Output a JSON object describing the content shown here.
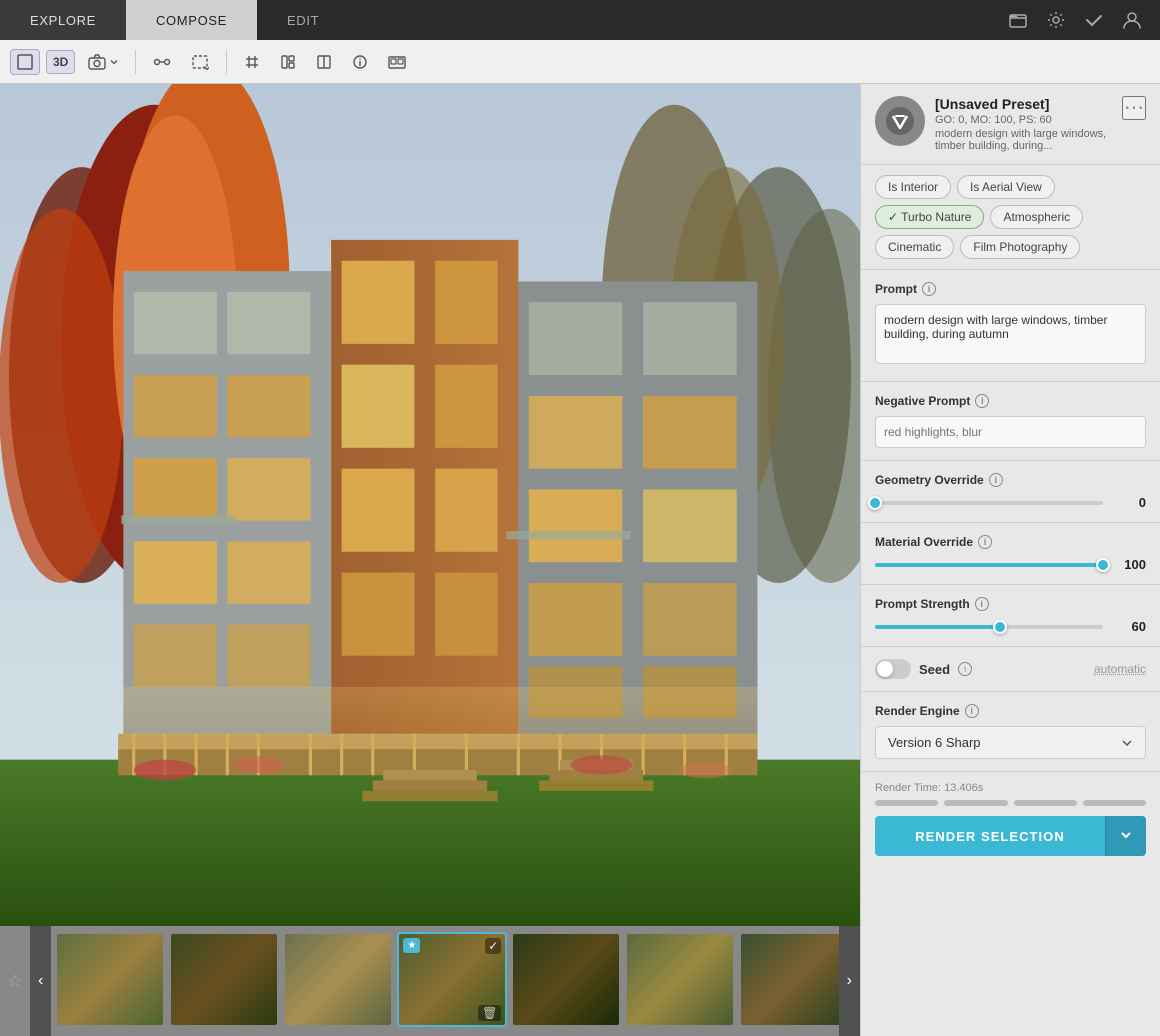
{
  "nav": {
    "tabs": [
      {
        "label": "EXPLORE",
        "active": false
      },
      {
        "label": "COMPOSE",
        "active": true
      },
      {
        "label": "EDIT",
        "active": false
      }
    ],
    "icons": [
      "folder-icon",
      "settings-icon",
      "check-icon",
      "user-icon"
    ]
  },
  "toolbar": {
    "buttons": [
      {
        "label": "⬜",
        "name": "frame-btn",
        "active": false
      },
      {
        "label": "3D",
        "name": "3d-btn",
        "active": true
      },
      {
        "label": "📷",
        "name": "camera-btn",
        "active": false
      },
      {
        "label": "↔",
        "name": "transform-btn",
        "active": false
      },
      {
        "label": "⬛",
        "name": "select-btn",
        "active": false
      },
      {
        "label": "⊹",
        "name": "grid-btn",
        "active": false
      },
      {
        "label": "▦",
        "name": "layout-btn",
        "active": false
      },
      {
        "label": "◫",
        "name": "split-btn",
        "active": false
      },
      {
        "label": "ℹ",
        "name": "info-btn",
        "active": false
      },
      {
        "label": "▣",
        "name": "gallery-btn",
        "active": false
      }
    ]
  },
  "preset": {
    "name": "[Unsaved Preset]",
    "meta": "GO: 0, MO: 100, PS: 60",
    "desc": "modern design with large windows, timber building, during..."
  },
  "tags": [
    {
      "label": "Is Interior",
      "active": false,
      "checked": false
    },
    {
      "label": "Is Aerial View",
      "active": false,
      "checked": false
    },
    {
      "label": "Turbo Nature",
      "active": true,
      "checked": true
    },
    {
      "label": "Atmospheric",
      "active": false,
      "checked": false
    },
    {
      "label": "Cinematic",
      "active": false,
      "checked": false
    },
    {
      "label": "Film Photography",
      "active": false,
      "checked": false
    }
  ],
  "prompt": {
    "label": "Prompt",
    "value": "modern design with large windows, timber building, during autumn"
  },
  "negative_prompt": {
    "label": "Negative Prompt",
    "placeholder": "red highlights, blur"
  },
  "geometry_override": {
    "label": "Geometry Override",
    "value": 0,
    "pct": 0
  },
  "material_override": {
    "label": "Material Override",
    "value": 100,
    "pct": 100
  },
  "prompt_strength": {
    "label": "Prompt Strength",
    "value": 60,
    "pct": 55
  },
  "seed": {
    "label": "Seed",
    "value": "automatic"
  },
  "render_engine": {
    "label": "Render Engine",
    "value": "Version 6 Sharp"
  },
  "render": {
    "time_label": "Render Time: 13.406s",
    "button_label": "RENDER SELECTION",
    "dropdown_label": "▾"
  }
}
